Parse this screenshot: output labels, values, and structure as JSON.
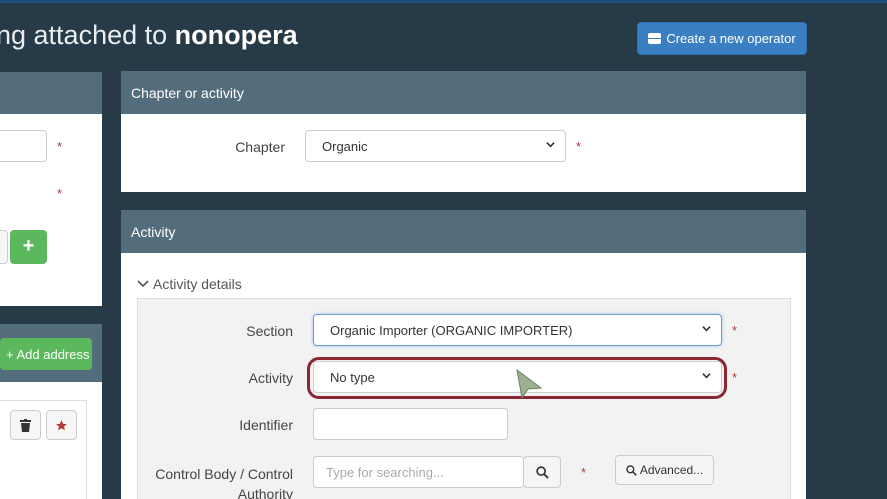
{
  "header": {
    "title_prefix": "ng attached to ",
    "title_bold": "nonopera",
    "create_button": "Create a new operator"
  },
  "left": {
    "add_button": "+",
    "add_address": "+ Add address"
  },
  "chapter_panel": {
    "title": "Chapter or activity",
    "chapter_label": "Chapter",
    "chapter_value": "Organic",
    "required": "*"
  },
  "activity_panel": {
    "title": "Activity",
    "details_title": "Activity details",
    "section_label": "Section",
    "section_value": "Organic Importer (ORGANIC IMPORTER)",
    "activity_label": "Activity",
    "activity_value": "No type",
    "identifier_label": "Identifier",
    "identifier_value": "",
    "control_label_1": "Control Body / Control",
    "control_label_2": "Authority",
    "control_placeholder": "Type for searching...",
    "advanced_button": "Advanced...",
    "required": "*"
  },
  "colors": {
    "background": "#263a47",
    "panel_header": "#546d7d",
    "primary": "#3a7fc2",
    "success": "#5cb85c",
    "highlight": "#8b2635"
  }
}
